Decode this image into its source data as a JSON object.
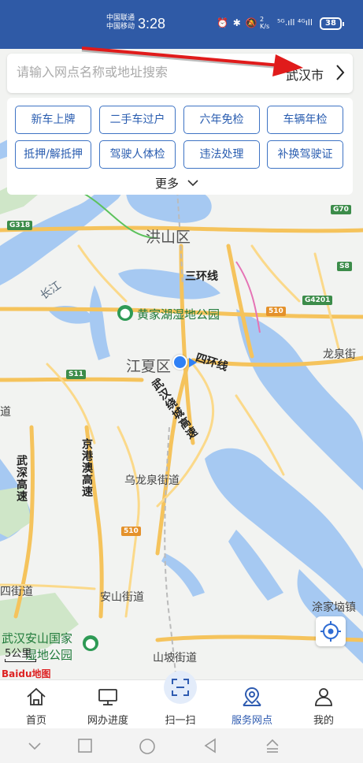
{
  "status_bar": {
    "carrier1": "中国联通",
    "carrier2": "中国移动",
    "time": "3:28",
    "icons": "⏰ ✱ 🔕",
    "net_speed_top": "2",
    "net_speed_bottom": "K/s",
    "signal": "⁵ᴳ.ıll ⁴ᴳıll",
    "battery": "38"
  },
  "search": {
    "placeholder": "请输入网点名称或地址搜索",
    "city": "武汉市"
  },
  "services": {
    "items": [
      "新车上牌",
      "二手车过户",
      "六年免检",
      "车辆年检",
      "抵押/解抵押",
      "驾驶人体检",
      "违法处理",
      "补换驾驶证"
    ],
    "more_label": "更多"
  },
  "map": {
    "labels": {
      "hongshan": "洪山区",
      "jiangxia": "江夏区",
      "huangjiahu": "黄家湖湿地公园",
      "sanhuan": "三环线",
      "sihuan": "四环线",
      "longquan": "龙泉街",
      "wulongquan": "乌龙泉街道",
      "anshan": "安山街道",
      "shanpo": "山坡街道",
      "tujiatai": "涂家垴镇",
      "si_dao": "四街道",
      "anshan_park_1": "武汉安山国家",
      "anshan_park_2": "湿地公园",
      "changjiang": "长江",
      "wuhan_ring": "武汉绕城高速",
      "jinggang": "京港澳高速",
      "wushen": "武深高速",
      "dao": "道"
    },
    "shields": {
      "g318": "G318",
      "g70": "G70",
      "s8": "S8",
      "g4201": "G4201",
      "s11": "S11",
      "n510a": "510",
      "n510b": "510"
    },
    "scale": "5公里",
    "provider": "Baidu地图"
  },
  "tabs": [
    {
      "label": "首页",
      "icon": "home-icon"
    },
    {
      "label": "网办进度",
      "icon": "monitor-icon"
    },
    {
      "label": "扫一扫",
      "icon": "scan-icon"
    },
    {
      "label": "服务网点",
      "icon": "map-pin-icon"
    },
    {
      "label": "我的",
      "icon": "user-icon"
    }
  ],
  "colors": {
    "brand_blue": "#2f5aa6",
    "button_border": "#3e73c4",
    "arrow_red": "#e01b1b"
  }
}
